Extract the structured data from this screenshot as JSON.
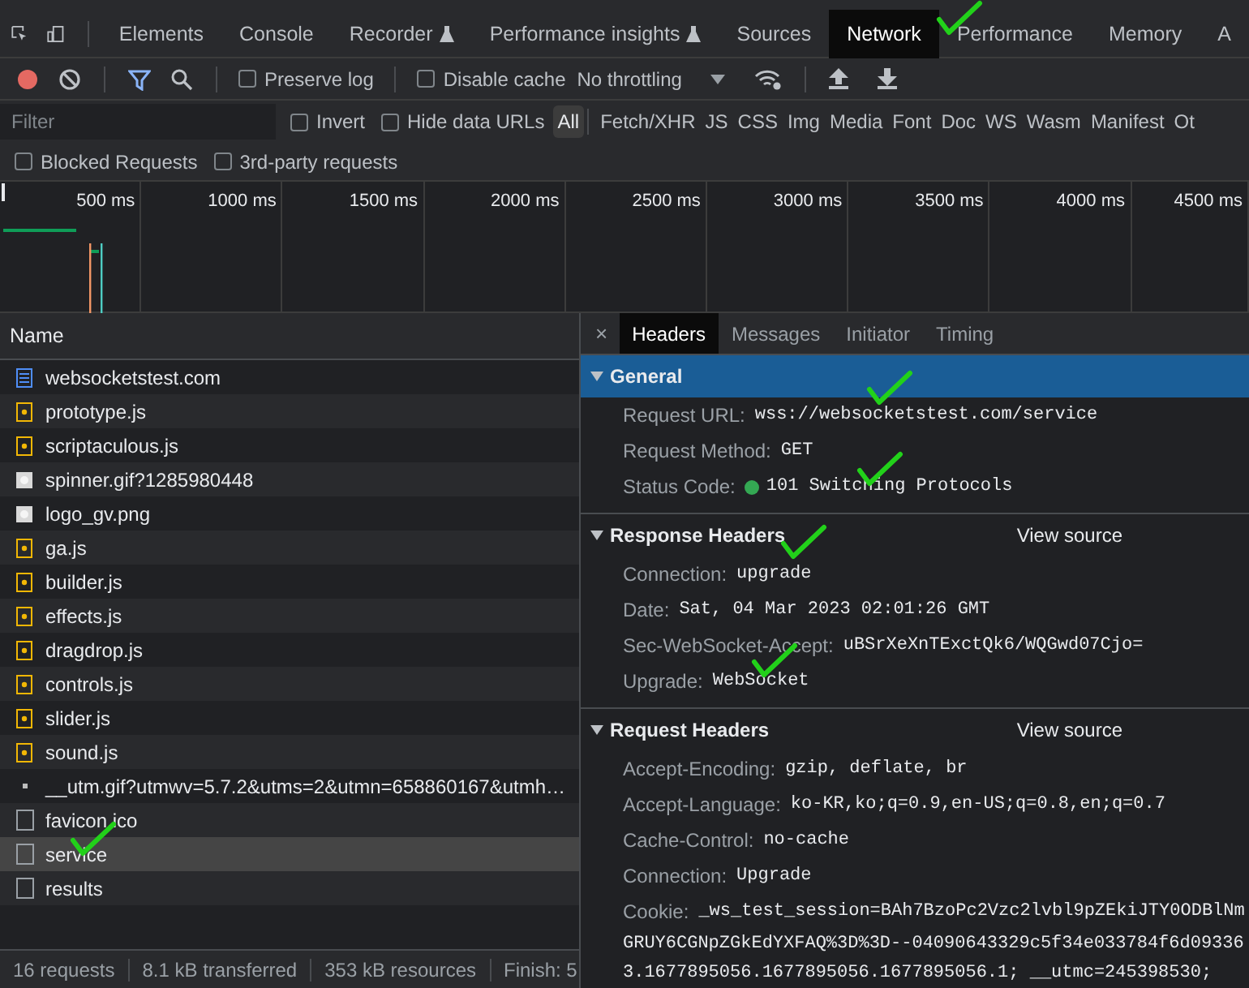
{
  "panel_tabs": [
    {
      "label": "Elements",
      "selected": false,
      "experimental": false
    },
    {
      "label": "Console",
      "selected": false,
      "experimental": false
    },
    {
      "label": "Recorder",
      "selected": false,
      "experimental": true
    },
    {
      "label": "Performance insights",
      "selected": false,
      "experimental": true
    },
    {
      "label": "Sources",
      "selected": false,
      "experimental": false
    },
    {
      "label": "Network",
      "selected": true,
      "experimental": false
    },
    {
      "label": "Performance",
      "selected": false,
      "experimental": false
    },
    {
      "label": "Memory",
      "selected": false,
      "experimental": false
    },
    {
      "label": "A",
      "selected": false,
      "experimental": false
    }
  ],
  "toolbar": {
    "recording": true,
    "filter_active": true,
    "preserve_log": {
      "label": "Preserve log",
      "checked": false
    },
    "disable_cache": {
      "label": "Disable cache",
      "checked": false
    },
    "throttling": "No throttling"
  },
  "filter_bar": {
    "placeholder": "Filter",
    "invert": {
      "label": "Invert",
      "checked": false
    },
    "hide_data_urls": {
      "label": "Hide data URLs",
      "checked": false
    },
    "types": [
      {
        "label": "All",
        "selected": true
      },
      {
        "label": "Fetch/XHR",
        "selected": false
      },
      {
        "label": "JS",
        "selected": false
      },
      {
        "label": "CSS",
        "selected": false
      },
      {
        "label": "Img",
        "selected": false
      },
      {
        "label": "Media",
        "selected": false
      },
      {
        "label": "Font",
        "selected": false
      },
      {
        "label": "Doc",
        "selected": false
      },
      {
        "label": "WS",
        "selected": false
      },
      {
        "label": "Wasm",
        "selected": false
      },
      {
        "label": "Manifest",
        "selected": false
      },
      {
        "label": "Ot",
        "selected": false
      }
    ],
    "blocked_requests": {
      "label": "Blocked Requests",
      "checked": false
    },
    "third_party": {
      "label": "3rd-party requests",
      "checked": false
    }
  },
  "overview": {
    "ticks": [
      "500 ms",
      "1000 ms",
      "1500 ms",
      "2000 ms",
      "2500 ms",
      "3000 ms",
      "3500 ms",
      "4000 ms",
      "4500 ms"
    ]
  },
  "requests": {
    "column": "Name",
    "rows": [
      {
        "name": "websocketstest.com",
        "kind": "document",
        "selected": false
      },
      {
        "name": "prototype.js",
        "kind": "script",
        "selected": false
      },
      {
        "name": "scriptaculous.js",
        "kind": "script",
        "selected": false
      },
      {
        "name": "spinner.gif?1285980448",
        "kind": "image",
        "selected": false
      },
      {
        "name": "logo_gv.png",
        "kind": "image",
        "selected": false
      },
      {
        "name": "ga.js",
        "kind": "script",
        "selected": false
      },
      {
        "name": "builder.js",
        "kind": "script",
        "selected": false
      },
      {
        "name": "effects.js",
        "kind": "script",
        "selected": false
      },
      {
        "name": "dragdrop.js",
        "kind": "script",
        "selected": false
      },
      {
        "name": "controls.js",
        "kind": "script",
        "selected": false
      },
      {
        "name": "slider.js",
        "kind": "script",
        "selected": false
      },
      {
        "name": "sound.js",
        "kind": "script",
        "selected": false
      },
      {
        "name": "__utm.gif?utmwv=5.7.2&utms=2&utmn=658860167&utmh…",
        "kind": "pixel",
        "selected": false
      },
      {
        "name": "favicon.ico",
        "kind": "other",
        "selected": false
      },
      {
        "name": "service",
        "kind": "other",
        "selected": true
      },
      {
        "name": "results",
        "kind": "other",
        "selected": false
      }
    ]
  },
  "status_bar": [
    "16 requests",
    "8.1 kB transferred",
    "353 kB resources",
    "Finish: 5"
  ],
  "detail": {
    "close": "×",
    "tabs": [
      {
        "label": "Headers",
        "selected": true
      },
      {
        "label": "Messages",
        "selected": false
      },
      {
        "label": "Initiator",
        "selected": false
      },
      {
        "label": "Timing",
        "selected": false
      }
    ],
    "sections": [
      {
        "title": "General",
        "expanded": true,
        "selected": true,
        "rows": [
          {
            "kind": "text",
            "name": "Request URL:",
            "value": "wss://websocketstest.com/service"
          },
          {
            "kind": "text",
            "name": "Request Method:",
            "value": "GET"
          },
          {
            "kind": "status",
            "name": "Status Code:",
            "value": "101 Switching Protocols"
          }
        ]
      },
      {
        "title": "Response Headers",
        "expanded": true,
        "selected": false,
        "action": "View source",
        "rows": [
          {
            "kind": "text",
            "name": "Connection:",
            "value": "upgrade"
          },
          {
            "kind": "text",
            "name": "Date:",
            "value": "Sat, 04 Mar 2023 02:01:26 GMT"
          },
          {
            "kind": "text",
            "name": "Sec-WebSocket-Accept:",
            "value": "uBSrXeXnTExctQk6/WQGwd07Cjo="
          },
          {
            "kind": "text",
            "name": "Upgrade:",
            "value": "WebSocket"
          }
        ]
      },
      {
        "title": "Request Headers",
        "expanded": true,
        "selected": false,
        "action": "View source",
        "rows": [
          {
            "kind": "text",
            "name": "Accept-Encoding:",
            "value": "gzip, deflate, br"
          },
          {
            "kind": "text",
            "name": "Accept-Language:",
            "value": "ko-KR,ko;q=0.9,en-US;q=0.8,en;q=0.7"
          },
          {
            "kind": "text",
            "name": "Cache-Control:",
            "value": "no-cache"
          },
          {
            "kind": "text",
            "name": "Connection:",
            "value": "Upgrade"
          },
          {
            "kind": "wrapped",
            "name": "Cookie:",
            "value": "_ws_test_session=BAh7BzoPc2Vzc2lvbl9pZEkiJTY0ODBlNm",
            "more": [
              "GRUY6CGNpZGkEdYXFAQ%3D%3D--04090643329c5f34e033784f6d09336",
              "3.1677895056.1677895056.1677895056.1;  __utmc=245398530;"
            ]
          }
        ]
      }
    ]
  }
}
